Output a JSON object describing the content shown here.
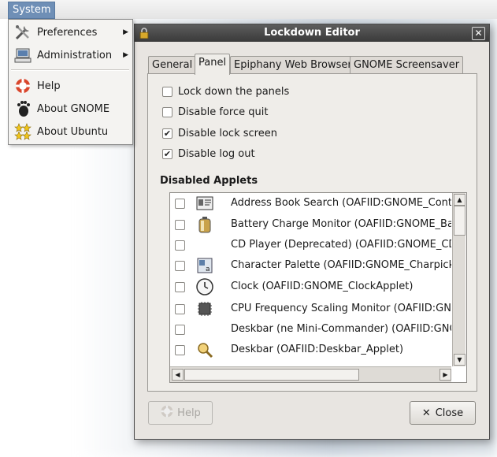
{
  "panel": {
    "system_label": "System"
  },
  "menu": {
    "items": [
      {
        "label": "Preferences",
        "icon": "preferences-icon",
        "submenu": true
      },
      {
        "label": "Administration",
        "icon": "administration-icon",
        "submenu": true
      },
      {
        "label": "Help",
        "icon": "help-icon",
        "submenu": false
      },
      {
        "label": "About GNOME",
        "icon": "gnome-foot-icon",
        "submenu": false
      },
      {
        "label": "About Ubuntu",
        "icon": "ubuntu-icon",
        "submenu": false
      }
    ]
  },
  "dialog": {
    "title": "Lockdown Editor",
    "tabs": [
      "General",
      "Panel",
      "Epiphany Web Browser",
      "GNOME Screensaver"
    ],
    "active_tab": "Panel",
    "options": [
      {
        "label": "Lock down the panels",
        "checked": false
      },
      {
        "label": "Disable force quit",
        "checked": false
      },
      {
        "label": "Disable lock screen",
        "checked": true
      },
      {
        "label": "Disable log out",
        "checked": true
      }
    ],
    "applets_heading": "Disabled Applets",
    "applets": [
      {
        "name": "Address Book Search (OAFIID:GNOME_ContactsApplet)",
        "icon": "address-book-icon",
        "checked": false
      },
      {
        "name": "Battery Charge Monitor (OAFIID:GNOME_BattstatApplet)",
        "icon": "battery-icon",
        "checked": false
      },
      {
        "name": "CD Player (Deprecated) (OAFIID:GNOME_CDPlayerApplet)",
        "icon": "",
        "checked": false
      },
      {
        "name": "Character Palette (OAFIID:GNOME_CharpickerApplet)",
        "icon": "character-palette-icon",
        "checked": false
      },
      {
        "name": "Clock (OAFIID:GNOME_ClockApplet)",
        "icon": "clock-icon",
        "checked": false
      },
      {
        "name": "CPU Frequency Scaling Monitor (OAFIID:GNOME_CPUFreqApplet)",
        "icon": "cpu-icon",
        "checked": false
      },
      {
        "name": "Deskbar (ne Mini-Commander) (OAFIID:GNOME_MiniCommanderApplet)",
        "icon": "",
        "checked": false
      },
      {
        "name": "Deskbar (OAFIID:Deskbar_Applet)",
        "icon": "deskbar-icon",
        "checked": false
      }
    ],
    "buttons": {
      "help": "Help",
      "close": "Close"
    }
  }
}
